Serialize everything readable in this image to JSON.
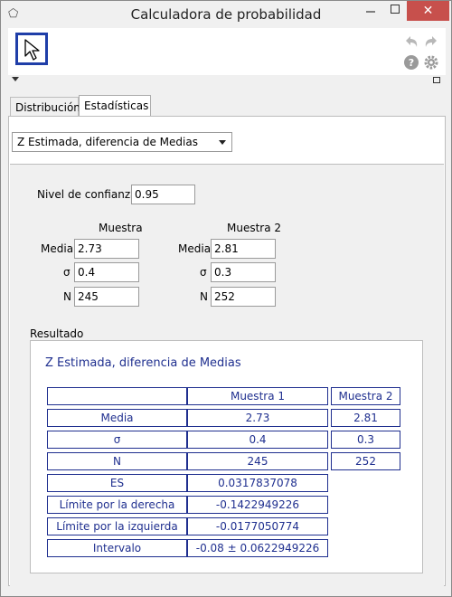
{
  "window": {
    "title": "Calculadora de probabilidad",
    "close_symbol": "✕"
  },
  "tabs": [
    {
      "label": "Distribución"
    },
    {
      "label": "Estadísticas"
    }
  ],
  "procedure": {
    "selected": "Z Estimada, diferencia de Medias"
  },
  "confidence": {
    "label": "Nivel de confianza",
    "value": "0.95"
  },
  "sample1": {
    "header": "Muestra",
    "rows": [
      {
        "label": "Media",
        "value": "2.73"
      },
      {
        "label": "σ",
        "value": "0.4"
      },
      {
        "label": "N",
        "value": "245"
      }
    ]
  },
  "sample2": {
    "header": "Muestra 2",
    "rows": [
      {
        "label": "Media",
        "value": "2.81"
      },
      {
        "label": "σ",
        "value": "0.3"
      },
      {
        "label": "N",
        "value": "252"
      }
    ]
  },
  "result": {
    "section_label": "Resultado",
    "title": "Z Estimada, diferencia de Medias",
    "headers": [
      "",
      "Muestra 1",
      "Muestra 2"
    ],
    "rows": [
      {
        "label": "Media",
        "m1": "2.73",
        "m2": "2.81"
      },
      {
        "label": "σ",
        "m1": "0.4",
        "m2": "0.3"
      },
      {
        "label": "N",
        "m1": "245",
        "m2": "252"
      },
      {
        "label": "ES",
        "m1": "0.0317837078",
        "m2": ""
      },
      {
        "label": "Límite por la derecha",
        "m1": "-0.1422949226",
        "m2": ""
      },
      {
        "label": "Límite por la izquierda",
        "m1": "-0.0177050774",
        "m2": ""
      },
      {
        "label": "Intervalo",
        "m1": "-0.08 ± 0.0622949226",
        "m2": ""
      }
    ]
  }
}
